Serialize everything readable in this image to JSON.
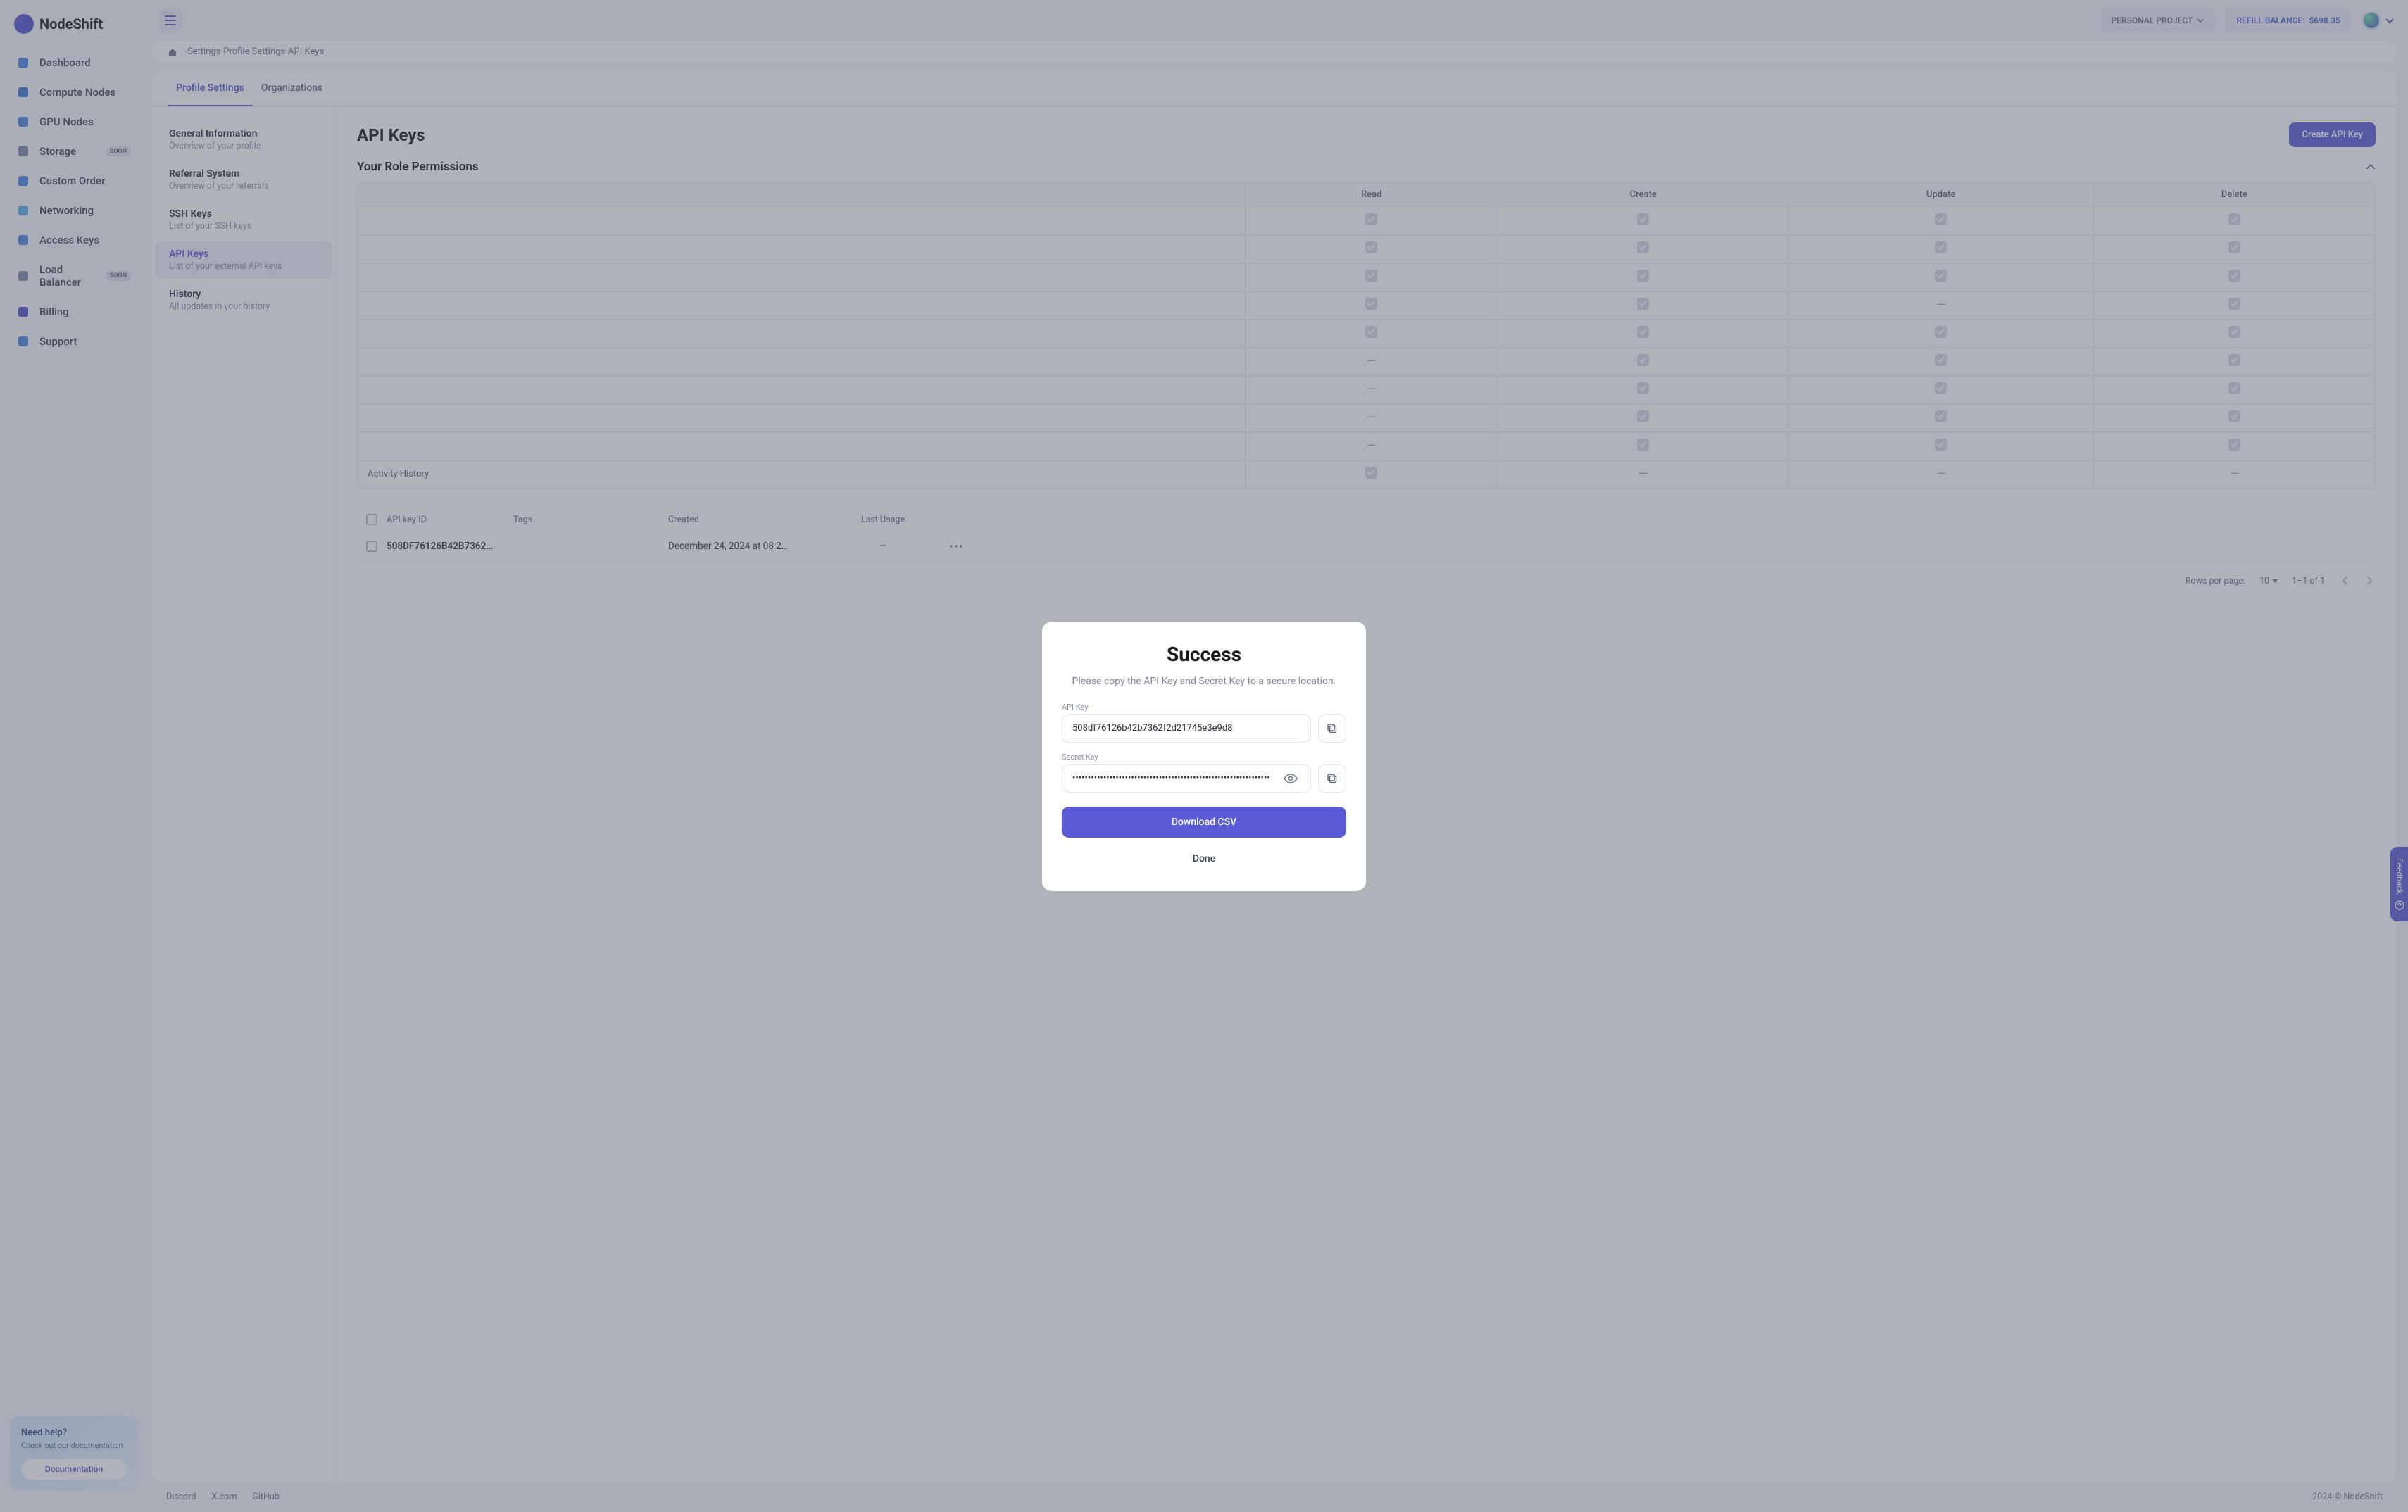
{
  "brand": "NodeShift",
  "topbar": {
    "project_label": "PERSONAL PROJECT",
    "balance_label": "REFILL BALANCE:",
    "balance_value": "$698.35"
  },
  "sidebar": {
    "items": [
      {
        "label": "Dashboard",
        "soon": false
      },
      {
        "label": "Compute Nodes",
        "soon": false
      },
      {
        "label": "GPU Nodes",
        "soon": false
      },
      {
        "label": "Storage",
        "soon": true
      },
      {
        "label": "Custom Order",
        "soon": false
      },
      {
        "label": "Networking",
        "soon": false
      },
      {
        "label": "Access Keys",
        "soon": false
      },
      {
        "label": "Load Balancer",
        "soon": true
      },
      {
        "label": "Billing",
        "soon": false
      },
      {
        "label": "Support",
        "soon": false
      }
    ],
    "soon_badge": "SOON",
    "help": {
      "title": "Need help?",
      "sub": "Check out our documentation",
      "button": "Documentation"
    }
  },
  "breadcrumb": [
    "Settings",
    "Profile Settings",
    "API Keys"
  ],
  "tabs": [
    {
      "label": "Profile Settings",
      "active": true
    },
    {
      "label": "Organizations",
      "active": false
    }
  ],
  "left_nav": [
    {
      "title": "General Information",
      "sub": "Overview of your profile",
      "active": false
    },
    {
      "title": "Referral System",
      "sub": "Overview of your referrals",
      "active": false
    },
    {
      "title": "SSH Keys",
      "sub": "List of your SSH keys",
      "active": false
    },
    {
      "title": "API Keys",
      "sub": "List of your external API keys",
      "active": true
    },
    {
      "title": "History",
      "sub": "All updates in your history",
      "active": false
    }
  ],
  "page": {
    "title": "API Keys",
    "create_btn": "Create API Key",
    "permissions_title": "Your Role Permissions"
  },
  "perm_headers": [
    "",
    "Read",
    "Create",
    "Update",
    "Delete"
  ],
  "perm_rows": [
    {
      "name": "",
      "cells": [
        "check",
        "check",
        "check",
        "check"
      ]
    },
    {
      "name": "",
      "cells": [
        "check",
        "check",
        "check",
        "check"
      ]
    },
    {
      "name": "",
      "cells": [
        "check",
        "check",
        "check",
        "check"
      ]
    },
    {
      "name": "",
      "cells": [
        "check",
        "check",
        "dash",
        "check"
      ]
    },
    {
      "name": "",
      "cells": [
        "check",
        "check",
        "check",
        "check"
      ]
    },
    {
      "name": "",
      "cells": [
        "dash",
        "check",
        "check",
        "check"
      ]
    },
    {
      "name": "",
      "cells": [
        "dash",
        "check",
        "check",
        "check"
      ]
    },
    {
      "name": "",
      "cells": [
        "dash",
        "check",
        "check",
        "check"
      ]
    },
    {
      "name": "",
      "cells": [
        "dash",
        "check",
        "check",
        "check"
      ]
    },
    {
      "name": "Activity History",
      "cells": [
        "check",
        "dash",
        "dash",
        "dash"
      ]
    }
  ],
  "key_table": {
    "headers": {
      "id": "API key ID",
      "tags": "Tags",
      "created": "Created",
      "last": "Last Usage"
    },
    "row": {
      "id": "508DF76126B42B7362…",
      "created": "December 24, 2024 at 08:2…",
      "last": "—"
    }
  },
  "pagination": {
    "rows_label": "Rows per page:",
    "rows_value": "10",
    "range": "1–1 of 1"
  },
  "footer": {
    "links": [
      "Discord",
      "X.com",
      "GitHub"
    ],
    "copy": "2024 © NodeShift"
  },
  "feedback": "Feedback",
  "modal": {
    "title": "Success",
    "sub": "Please copy the API Key and Secret Key to a secure location.",
    "api_label": "API Key",
    "api_value": "508df76126b42b7362f2d21745e3e9d8",
    "secret_label": "Secret Key",
    "secret_value": "••••••••••••••••••••••••••••••••••••••••••••••••••••••••••••••••",
    "download": "Download CSV",
    "done": "Done"
  }
}
